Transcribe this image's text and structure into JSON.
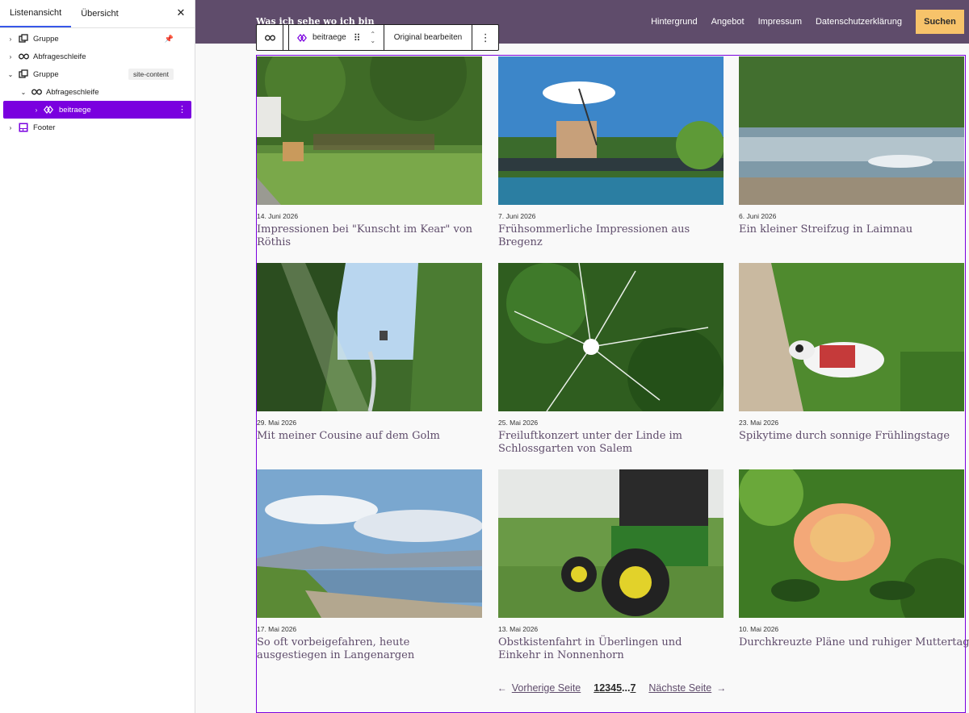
{
  "list_panel": {
    "tabs": [
      {
        "label": "Listenansicht",
        "active": true
      },
      {
        "label": "Übersicht",
        "active": false
      }
    ],
    "close_icon": "close-icon",
    "tree": [
      {
        "label": "Gruppe",
        "icon": "group-icon",
        "indent": 0,
        "extra": "pin"
      },
      {
        "label": "Abfrageschleife",
        "icon": "loop-icon",
        "indent": 0
      },
      {
        "label": "Gruppe",
        "icon": "group-icon",
        "indent": 0,
        "badge": "site-content",
        "expanded": true
      },
      {
        "label": "Abfrageschleife",
        "icon": "loop-icon",
        "indent": 1,
        "expanded": true
      },
      {
        "label": "beitraege",
        "icon": "pattern-icon",
        "indent": 2,
        "selected": true
      },
      {
        "label": "Footer",
        "icon": "footer-icon",
        "indent": 0
      }
    ]
  },
  "site": {
    "title": "Was ich sehe wo ich bin",
    "nav": [
      "Hintergrund",
      "Angebot",
      "Impressum",
      "Datenschutzerklärung"
    ],
    "search_label": "Suchen",
    "accent": "#5f4c6b",
    "button_color": "#f7c36a"
  },
  "toolbar": {
    "pattern_label": "beitraege",
    "edit_label": "Original bearbeiten"
  },
  "posts": [
    {
      "date": "14. Juni 2026",
      "title": "Impressionen bei \"Kunscht im Kear\" von Röthis"
    },
    {
      "date": "7. Juni 2026",
      "title": "Frühsommerliche Impressionen aus Bregenz"
    },
    {
      "date": "6. Juni 2026",
      "title": "Ein kleiner Streifzug in Laimnau"
    },
    {
      "date": "29. Mai 2026",
      "title": "Mit meiner Cousine auf dem Golm"
    },
    {
      "date": "25. Mai 2026",
      "title": "Freiluftkonzert unter der Linde im Schlossgarten von Salem"
    },
    {
      "date": "23. Mai 2026",
      "title": "Spikytime durch sonnige Frühlingstage"
    },
    {
      "date": "17. Mai 2026",
      "title": "So oft vorbeigefahren, heute ausgestiegen in Langenargen"
    },
    {
      "date": "13. Mai 2026",
      "title": "Obstkistenfahrt in Überlingen und Einkehr in Nonnenhorn"
    },
    {
      "date": "10. Mai 2026",
      "title": "Durchkreuzte Pläne und ruhiger Muttertag"
    }
  ],
  "pagination": {
    "prev": "Vorherige Seite",
    "next": "Nächste Seite",
    "pages": [
      "1",
      "2",
      "3",
      "4",
      "5"
    ],
    "ellipsis": "...",
    "last": "7"
  }
}
